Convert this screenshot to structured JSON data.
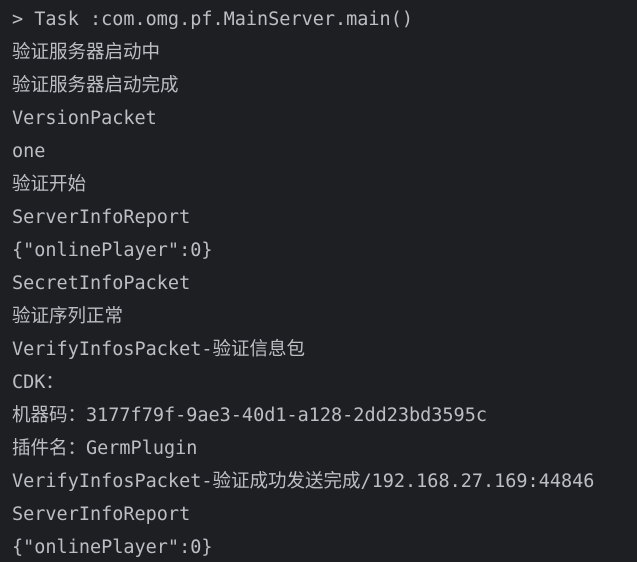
{
  "console": {
    "lines": [
      "> Task :com.omg.pf.MainServer.main()",
      "验证服务器启动中",
      "验证服务器启动完成",
      "VersionPacket",
      "one",
      "验证开始",
      "ServerInfoReport",
      "{\"onlinePlayer\":0}",
      "SecretInfoPacket",
      "验证序列正常",
      "VerifyInfosPacket-验证信息包",
      "CDK：",
      "机器码：3177f79f-9ae3-40d1-a128-2dd23bd3595c",
      "插件名：GermPlugin",
      "VerifyInfosPacket-验证成功发送完成/192.168.27.169:44846",
      "ServerInfoReport",
      "{\"onlinePlayer\":0}"
    ]
  },
  "colors": {
    "background": "#1e1f22",
    "text": "#bcbec4"
  }
}
